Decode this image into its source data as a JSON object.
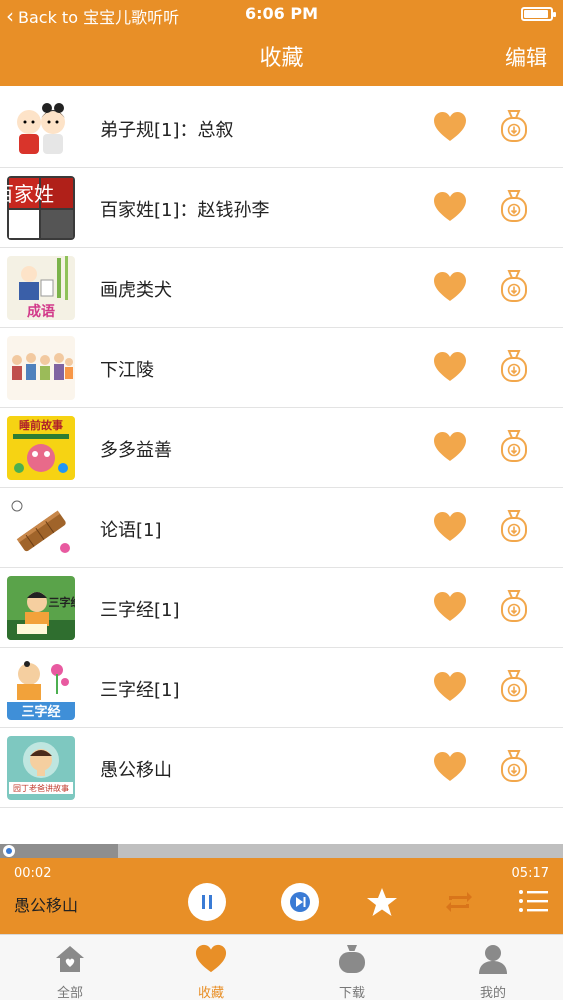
{
  "colors": {
    "accent": "#e88f27",
    "heart": "#f2a74b",
    "tab_inactive": "#8a8a8a"
  },
  "status_bar": {
    "back_label": "Back to 宝宝儿歌听听",
    "time": "6:06 PM"
  },
  "nav": {
    "title": "收藏",
    "edit_label": "编辑"
  },
  "items": [
    {
      "title": "弟子规[1]：总叙",
      "thumb_icon": "two-children-cartoon"
    },
    {
      "title": "百家姓[1]：赵钱孙李",
      "thumb_icon": "baijiaxing-calligraphy",
      "thumb_text": "百家姓"
    },
    {
      "title": "画虎类犬",
      "thumb_icon": "idiom-painter-cartoon",
      "thumb_text": "成语"
    },
    {
      "title": "下江陵",
      "thumb_icon": "crowd-cartoon"
    },
    {
      "title": "多多益善",
      "thumb_icon": "bedtime-story-cartoon",
      "thumb_text": "睡前故事"
    },
    {
      "title": "论语[1]",
      "thumb_icon": "bamboo-scroll"
    },
    {
      "title": "三字经[1]",
      "thumb_icon": "sanzijing-child-reading",
      "thumb_text": "三字经"
    },
    {
      "title": "三字经[1]",
      "thumb_icon": "sanzijing-child-flowers",
      "thumb_text": "三字经"
    },
    {
      "title": "愚公移山",
      "thumb_icon": "storyteller-avatar",
      "thumb_text": "园丁老爸讲故事"
    }
  ],
  "player": {
    "current_time": "00:02",
    "total_time": "05:17",
    "progress_fraction": 0.006,
    "buffered_fraction": 0.21,
    "now_playing": "愚公移山"
  },
  "tabs": [
    {
      "label": "全部",
      "icon": "home-icon",
      "active": false
    },
    {
      "label": "收藏",
      "icon": "heart-icon",
      "active": true
    },
    {
      "label": "下载",
      "icon": "download-bag-icon",
      "active": false
    },
    {
      "label": "我的",
      "icon": "person-icon",
      "active": false
    }
  ]
}
